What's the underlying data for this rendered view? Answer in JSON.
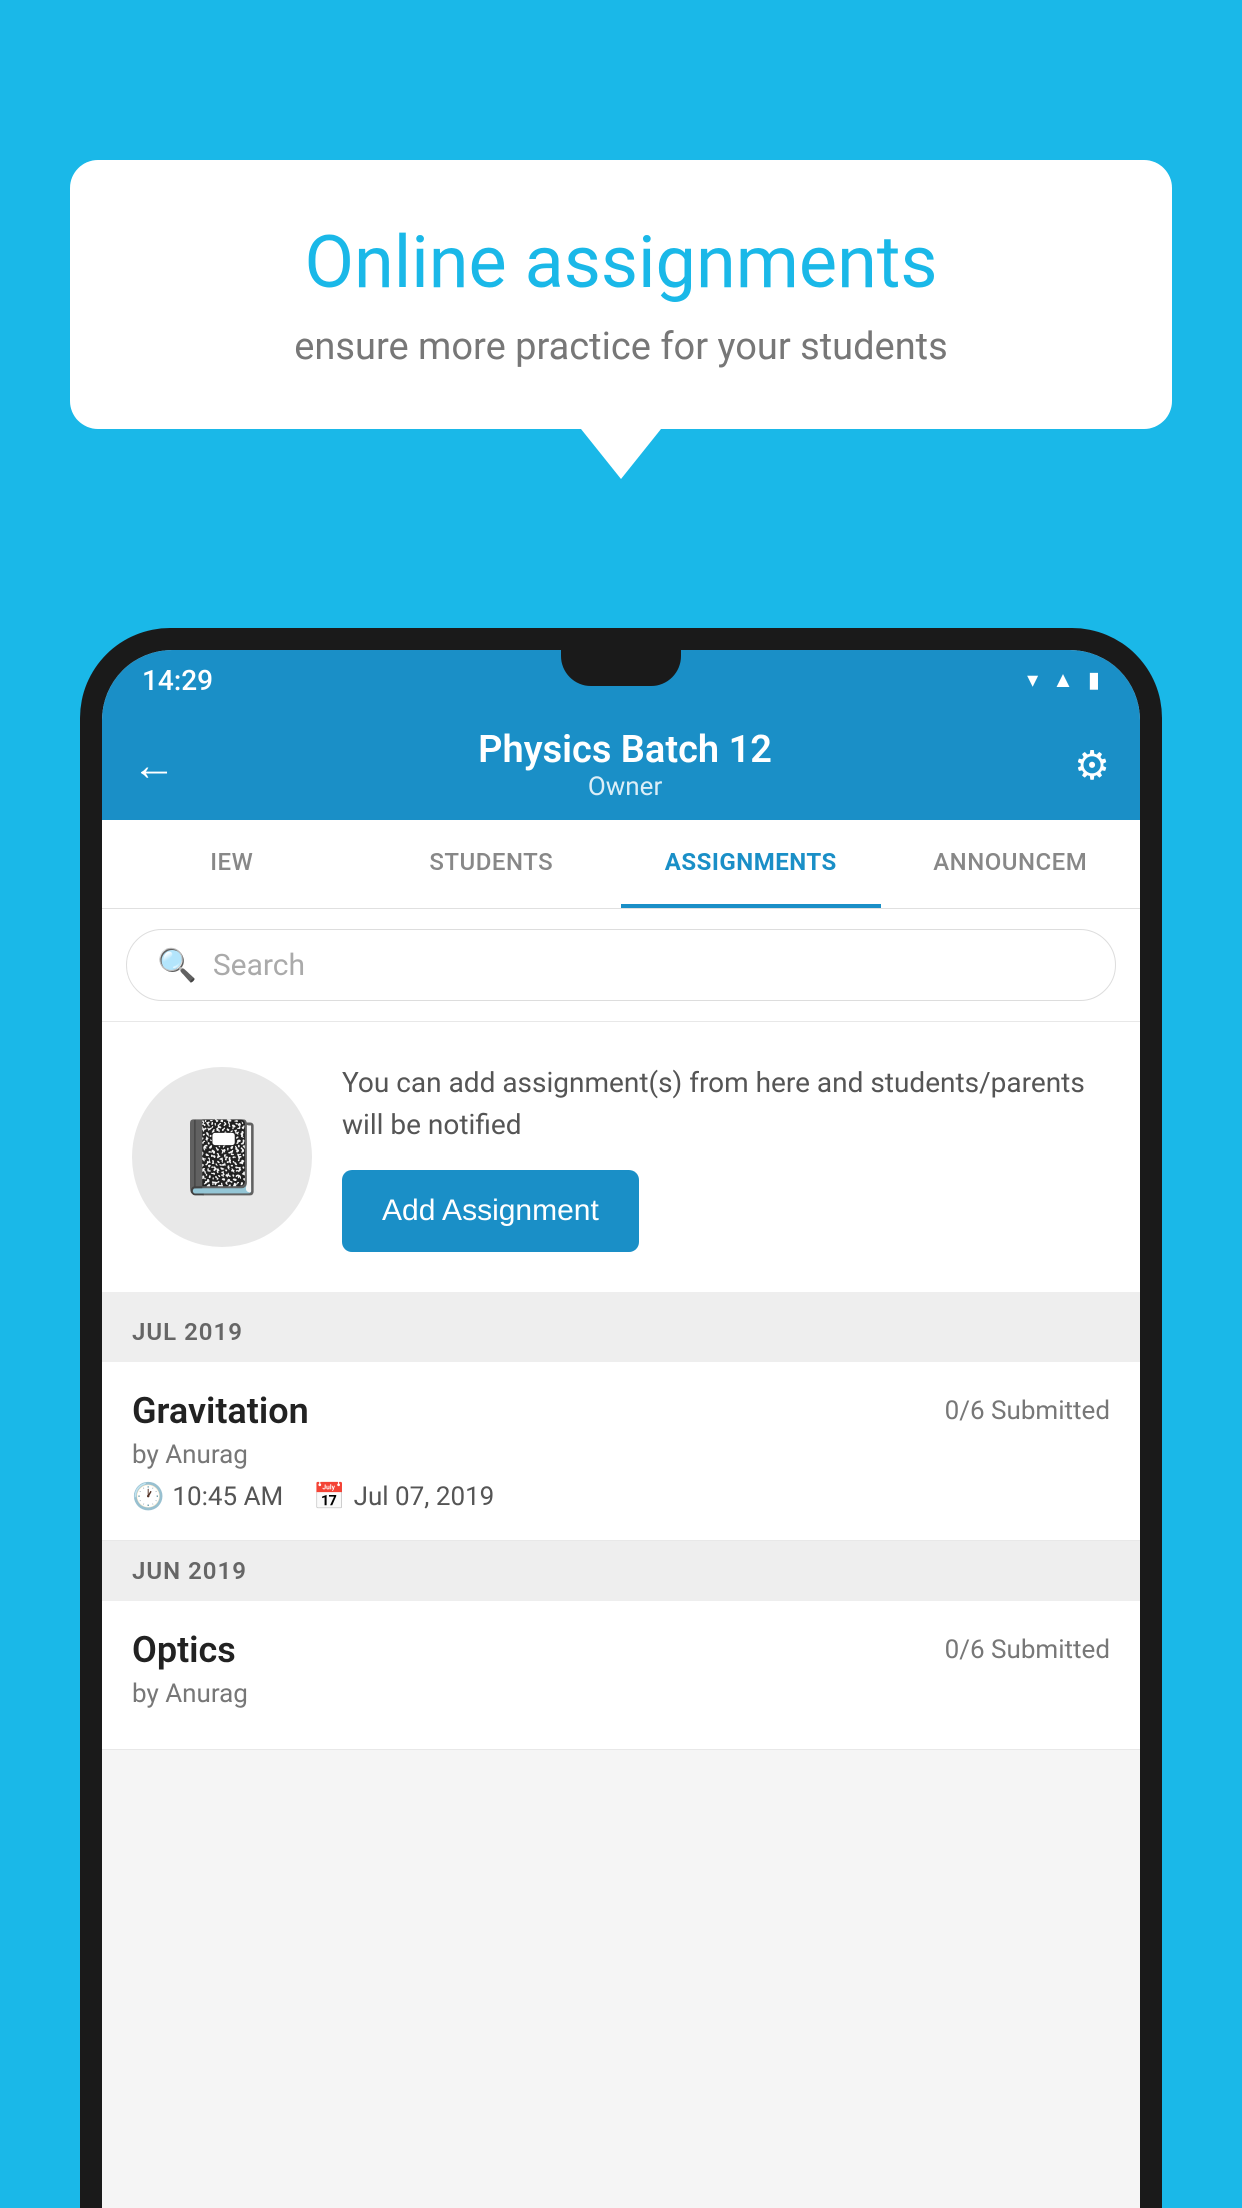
{
  "background_color": "#1ab8e8",
  "speech_bubble": {
    "title": "Online assignments",
    "subtitle": "ensure more practice for your students"
  },
  "status_bar": {
    "time": "14:29",
    "wifi_icon": "wifi-icon",
    "signal_icon": "signal-icon",
    "battery_icon": "battery-icon"
  },
  "app_bar": {
    "title": "Physics Batch 12",
    "subtitle": "Owner",
    "back_label": "←",
    "settings_label": "⚙"
  },
  "tabs": [
    {
      "label": "IEW",
      "active": false
    },
    {
      "label": "STUDENTS",
      "active": false
    },
    {
      "label": "ASSIGNMENTS",
      "active": true
    },
    {
      "label": "ANNOUNCEM",
      "active": false
    }
  ],
  "search": {
    "placeholder": "Search"
  },
  "add_assignment_section": {
    "info_text": "You can add assignment(s) from here and students/parents will be notified",
    "button_label": "Add Assignment"
  },
  "sections": [
    {
      "label": "JUL 2019",
      "items": [
        {
          "name": "Gravitation",
          "submitted": "0/6 Submitted",
          "by": "by Anurag",
          "time": "10:45 AM",
          "date": "Jul 07, 2019"
        }
      ]
    },
    {
      "label": "JUN 2019",
      "items": [
        {
          "name": "Optics",
          "submitted": "0/6 Submitted",
          "by": "by Anurag",
          "time": "",
          "date": ""
        }
      ]
    }
  ]
}
